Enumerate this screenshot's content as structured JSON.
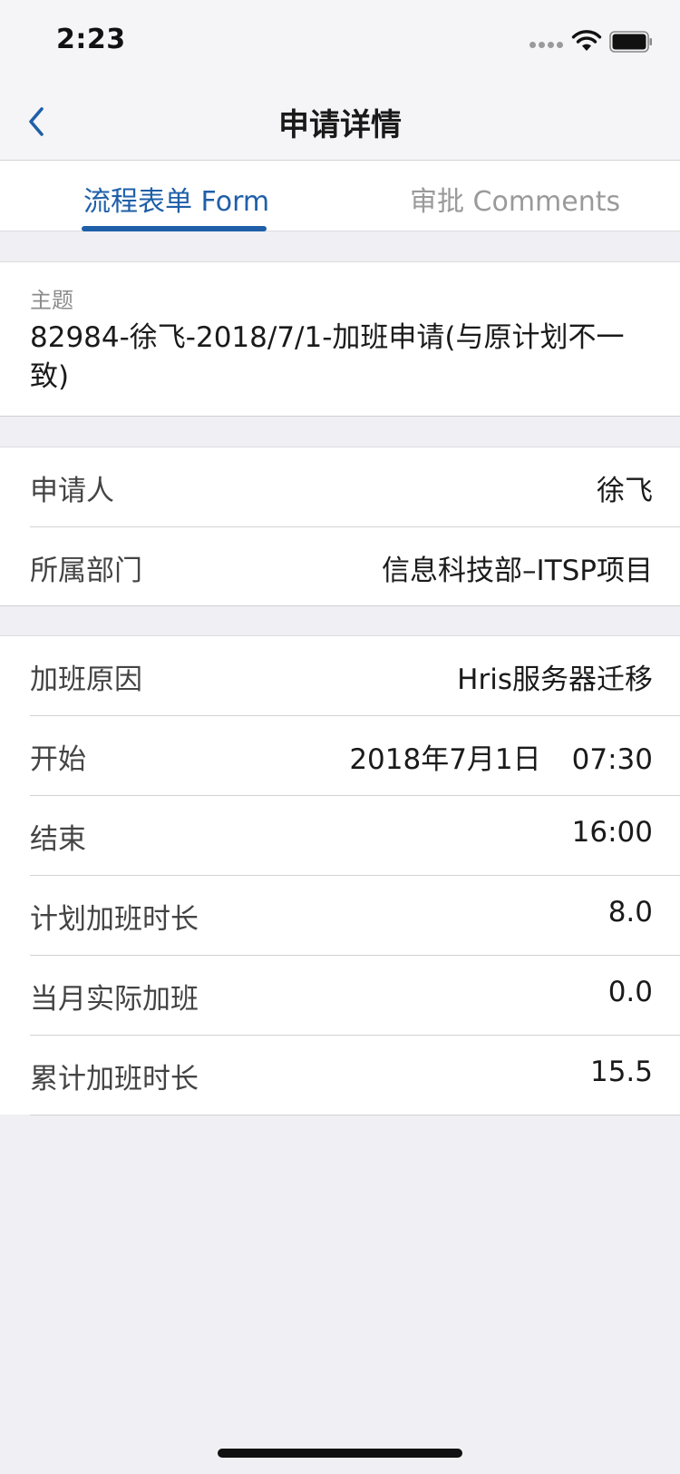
{
  "status_bar": {
    "time": "2:23"
  },
  "nav": {
    "title": "申请详情"
  },
  "tabs": [
    {
      "label": "流程表单 Form",
      "active": true
    },
    {
      "label": "审批 Comments",
      "active": false
    }
  ],
  "subject": {
    "label": "主题",
    "value": "82984-徐飞-2018/7/1-加班申请(与原计划不一致)"
  },
  "applicant_group": [
    {
      "label": "申请人",
      "value": "徐飞"
    },
    {
      "label": "所属部门",
      "value": "信息科技部–ITSP项目"
    }
  ],
  "overtime_group": {
    "reason": {
      "label": "加班原因",
      "value": "Hris服务器迁移"
    },
    "start": {
      "label": "开始",
      "date": "2018年7月1日",
      "time": "07:30"
    },
    "end": {
      "label": "结束",
      "value": "16:00"
    },
    "planned_hours": {
      "label": "计划加班时长",
      "value": "8.0"
    },
    "month_actual": {
      "label": "当月实际加班",
      "value": "0.0"
    },
    "cumulative_hours": {
      "label": "累计加班时长",
      "value": "15.5"
    }
  },
  "colors": {
    "accent": "#1f5fa8",
    "background": "#efeff4",
    "inactive_tab": "#9a9a9a"
  },
  "icons": {
    "back": "chevron-left-icon",
    "wifi": "wifi-icon",
    "battery": "battery-icon",
    "signal": "signal-dots-icon"
  }
}
